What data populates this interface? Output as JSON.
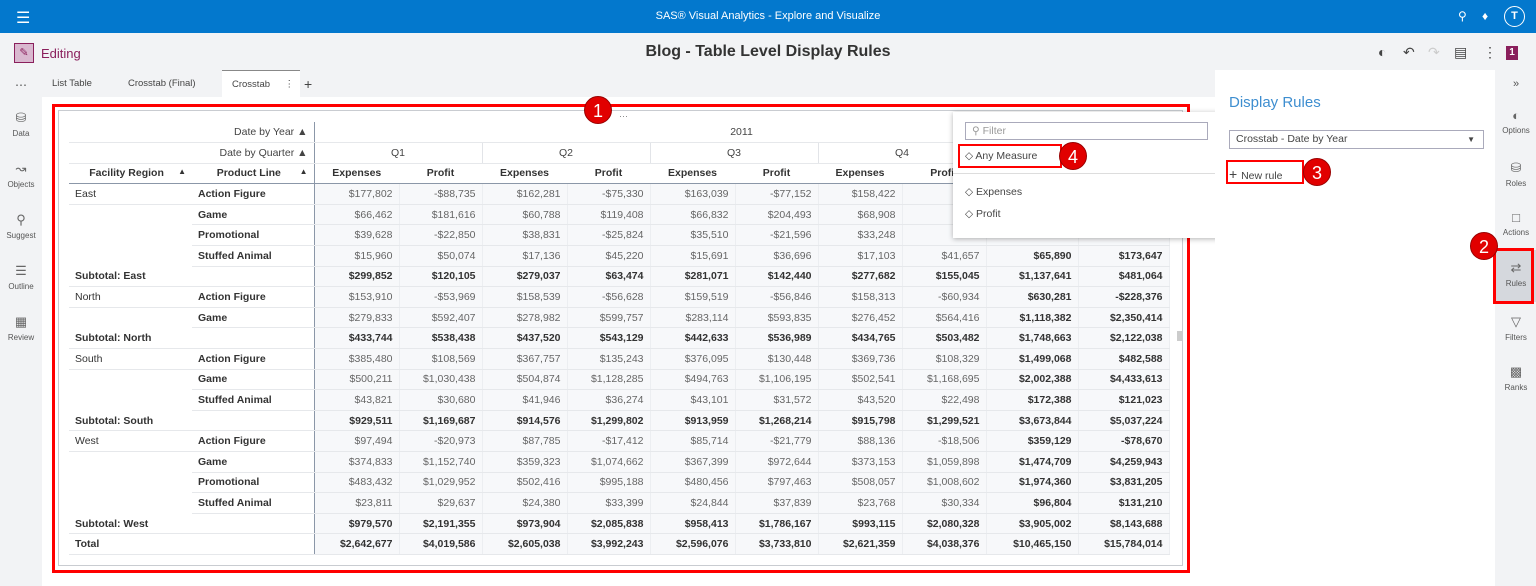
{
  "app": {
    "title": "SAS® Visual Analytics - Explore and Visualize",
    "mode": "Editing",
    "report_title": "Blog - Table Level Display Rules",
    "notification_count": "1",
    "user_initial": "T"
  },
  "left_rail": [
    {
      "label": "Data",
      "icon": "database-icon"
    },
    {
      "label": "Objects",
      "icon": "chart-icon"
    },
    {
      "label": "Suggest",
      "icon": "lightbulb-icon"
    },
    {
      "label": "Outline",
      "icon": "list-icon"
    },
    {
      "label": "Review",
      "icon": "review-icon"
    }
  ],
  "tabs": [
    {
      "label": "List Table"
    },
    {
      "label": "Crosstab (Final)"
    },
    {
      "label": "Crosstab",
      "active": true
    }
  ],
  "crosstab": {
    "year_label": "Date by Year",
    "year": "2011",
    "quarter_label": "Date by Quarter",
    "quarters": [
      "Q1",
      "Q2",
      "Q3",
      "Q4"
    ],
    "row_headers": [
      "Facility Region",
      "Product Line"
    ],
    "measures": [
      "Expenses",
      "Profit"
    ],
    "rows": [
      {
        "region": "East",
        "product": "Action Figure",
        "values": [
          "$177,802",
          "-$88,735",
          "$162,281",
          "-$75,330",
          "$163,039",
          "-$77,152",
          "$158,422",
          "",
          "",
          ""
        ]
      },
      {
        "region": "",
        "product": "Game",
        "values": [
          "$66,462",
          "$181,616",
          "$60,788",
          "$119,408",
          "$66,832",
          "$204,493",
          "$68,908",
          "",
          "",
          ""
        ]
      },
      {
        "region": "",
        "product": "Promotional",
        "values": [
          "$39,628",
          "-$22,850",
          "$38,831",
          "-$25,824",
          "$35,510",
          "-$21,596",
          "$33,248",
          "",
          "",
          ""
        ]
      },
      {
        "region": "",
        "product": "Stuffed Animal",
        "values": [
          "$15,960",
          "$50,074",
          "$17,136",
          "$45,220",
          "$15,691",
          "$36,696",
          "$17,103",
          "$41,657",
          "$65,890",
          "$173,647"
        ]
      },
      {
        "subtotal": "Subtotal: East",
        "values": [
          "$299,852",
          "$120,105",
          "$279,037",
          "$63,474",
          "$281,071",
          "$142,440",
          "$277,682",
          "$155,045",
          "$1,137,641",
          "$481,064"
        ]
      },
      {
        "region": "North",
        "product": "Action Figure",
        "values": [
          "$153,910",
          "-$53,969",
          "$158,539",
          "-$56,628",
          "$159,519",
          "-$56,846",
          "$158,313",
          "-$60,934",
          "$630,281",
          "-$228,376"
        ]
      },
      {
        "region": "",
        "product": "Game",
        "values": [
          "$279,833",
          "$592,407",
          "$278,982",
          "$599,757",
          "$283,114",
          "$593,835",
          "$276,452",
          "$564,416",
          "$1,118,382",
          "$2,350,414"
        ]
      },
      {
        "subtotal": "Subtotal: North",
        "values": [
          "$433,744",
          "$538,438",
          "$437,520",
          "$543,129",
          "$442,633",
          "$536,989",
          "$434,765",
          "$503,482",
          "$1,748,663",
          "$2,122,038"
        ]
      },
      {
        "region": "South",
        "product": "Action Figure",
        "values": [
          "$385,480",
          "$108,569",
          "$367,757",
          "$135,243",
          "$376,095",
          "$130,448",
          "$369,736",
          "$108,329",
          "$1,499,068",
          "$482,588"
        ]
      },
      {
        "region": "",
        "product": "Game",
        "values": [
          "$500,211",
          "$1,030,438",
          "$504,874",
          "$1,128,285",
          "$494,763",
          "$1,106,195",
          "$502,541",
          "$1,168,695",
          "$2,002,388",
          "$4,433,613"
        ]
      },
      {
        "region": "",
        "product": "Stuffed Animal",
        "values": [
          "$43,821",
          "$30,680",
          "$41,946",
          "$36,274",
          "$43,101",
          "$31,572",
          "$43,520",
          "$22,498",
          "$172,388",
          "$121,023"
        ]
      },
      {
        "subtotal": "Subtotal: South",
        "values": [
          "$929,511",
          "$1,169,687",
          "$914,576",
          "$1,299,802",
          "$913,959",
          "$1,268,214",
          "$915,798",
          "$1,299,521",
          "$3,673,844",
          "$5,037,224"
        ]
      },
      {
        "region": "West",
        "product": "Action Figure",
        "values": [
          "$97,494",
          "-$20,973",
          "$87,785",
          "-$17,412",
          "$85,714",
          "-$21,779",
          "$88,136",
          "-$18,506",
          "$359,129",
          "-$78,670"
        ]
      },
      {
        "region": "",
        "product": "Game",
        "values": [
          "$374,833",
          "$1,152,740",
          "$359,323",
          "$1,074,662",
          "$367,399",
          "$972,644",
          "$373,153",
          "$1,059,898",
          "$1,474,709",
          "$4,259,943"
        ]
      },
      {
        "region": "",
        "product": "Promotional",
        "values": [
          "$483,432",
          "$1,029,952",
          "$502,416",
          "$995,188",
          "$480,456",
          "$797,463",
          "$508,057",
          "$1,008,602",
          "$1,974,360",
          "$3,831,205"
        ]
      },
      {
        "region": "",
        "product": "Stuffed Animal",
        "values": [
          "$23,811",
          "$29,637",
          "$24,380",
          "$33,399",
          "$24,844",
          "$37,839",
          "$23,768",
          "$30,334",
          "$96,804",
          "$131,210"
        ]
      },
      {
        "subtotal": "Subtotal: West",
        "values": [
          "$979,570",
          "$2,191,355",
          "$973,904",
          "$2,085,838",
          "$958,413",
          "$1,786,167",
          "$993,115",
          "$2,080,328",
          "$3,905,002",
          "$8,143,688"
        ]
      },
      {
        "subtotal": "Total",
        "values": [
          "$2,642,677",
          "$4,019,586",
          "$2,605,038",
          "$3,992,243",
          "$2,596,076",
          "$3,733,810",
          "$2,621,359",
          "$4,038,376",
          "$10,465,150",
          "$15,784,014"
        ]
      }
    ]
  },
  "popup": {
    "filter_placeholder": "Filter",
    "any_measure": "Any Measure",
    "measures": [
      "Expenses",
      "Profit"
    ]
  },
  "display_rules": {
    "title": "Display Rules",
    "selected_object": "Crosstab - Date by Year",
    "new_rule": "New rule"
  },
  "right_rail": [
    {
      "label": "Options"
    },
    {
      "label": "Roles"
    },
    {
      "label": "Actions"
    },
    {
      "label": "Rules"
    },
    {
      "label": "Filters"
    },
    {
      "label": "Ranks"
    }
  ],
  "callouts": [
    "1",
    "2",
    "3",
    "4"
  ],
  "colors": {
    "brand": "#0378cd",
    "annotation": "#ff0000",
    "accent": "#8a1f5c"
  }
}
